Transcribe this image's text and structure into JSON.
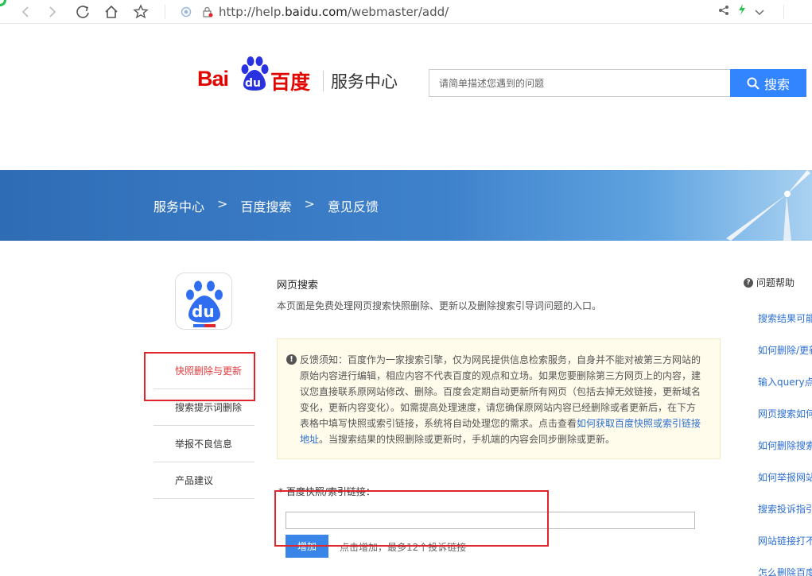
{
  "browser": {
    "url_prefix": "http://help.",
    "url_host": "baidu.com",
    "url_path": "/webmaster/add/"
  },
  "header": {
    "logo_bai": "Bai",
    "logo_du": "du",
    "logo_cn": "百度",
    "service_title": "服务中心",
    "search_placeholder": "请简单描述您遇到的问题",
    "search_button": "搜索"
  },
  "breadcrumb": {
    "items": [
      "服务中心",
      "百度搜索",
      "意见反馈"
    ],
    "separator": ">"
  },
  "sidebar": {
    "app_logo_text": "du",
    "items": [
      {
        "label": "快照删除与更新",
        "active": true
      },
      {
        "label": "搜索提示词删除",
        "active": false
      },
      {
        "label": "举报不良信息",
        "active": false
      },
      {
        "label": "产品建议",
        "active": false
      }
    ]
  },
  "main": {
    "title": "网页搜索",
    "description": "本页面是免费处理网页搜索快照删除、更新以及删除搜索引导词问题的入口。",
    "notice_text_1": "反馈须知：百度作为一家搜索引擎，仅为网民提供信息检索服务，自身并不能对被第三方网站的原始内容进行编辑，相应内容不代表百度的观点和立场。如果您要删除第三方网页上的内容，建议您直接联系原网站修改、删除。百度会定期自动更新所有网页（包括去掉无效链接，更新域名变化，更新内容变化）。如需提高处理速度，请您确保原网站内容已经删除或者更新后，在下方表格中填写快照或索引链接，系统将自动处理您的需求。点击查看",
    "notice_link": "如何获取百度快照或索引链接地址",
    "notice_text_2": "。当搜索结果的快照删除或更新时，手机端的内容会同步删除或更新。",
    "field_label": "* 百度快照/索引链接：",
    "add_button": "增加",
    "add_hint": "点击增加，最多12个投诉链接"
  },
  "help": {
    "title": "问题帮助",
    "links": [
      "搜索结果可能",
      "如何删除/更新",
      "输入query点",
      "网页搜索如何",
      "如何删除搜索",
      "如何举报网站",
      "搜索投诉指引",
      "网站链接打不",
      "怎么删除百度"
    ]
  },
  "colors": {
    "brand_red": "#e10601",
    "brand_blue": "#3385ff",
    "link_blue": "#2e6fd0",
    "highlight_red": "#e0252b"
  }
}
